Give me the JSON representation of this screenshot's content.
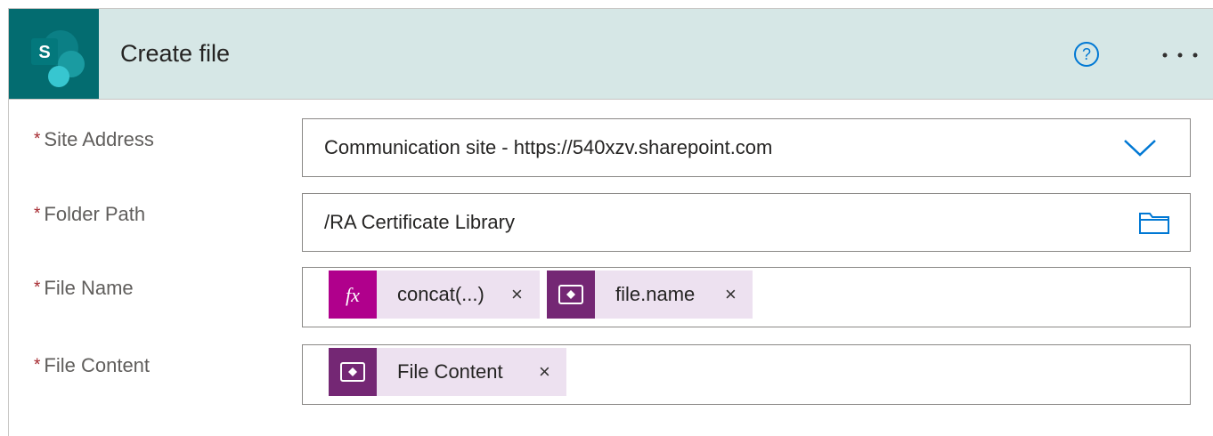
{
  "action": {
    "title": "Create file",
    "app_icon": "sharepoint-icon",
    "help_icon": "question-circle-icon",
    "more_label": "• • •"
  },
  "colors": {
    "header_bg": "#d6e7e6",
    "app_icon_bg": "#036c70",
    "required": "#a4262c",
    "help_blue": "#0078d4",
    "expression_token_icon": "#b0008c",
    "dynamic_token_icon": "#742774",
    "token_bg": "#ede1f0"
  },
  "fields": {
    "site_address": {
      "label": "Site Address",
      "required_mark": "*",
      "value": "Communication site - https://540xzv.sharepoint.com",
      "icon": "chevron-down-icon"
    },
    "folder_path": {
      "label": "Folder Path",
      "required_mark": "*",
      "value": "/RA Certificate Library",
      "icon": "folder-icon"
    },
    "file_name": {
      "label": "File Name",
      "required_mark": "*",
      "tokens": [
        {
          "label": "concat(...)",
          "icon": "fx-expression-icon",
          "remove": "×"
        },
        {
          "label": "file.name",
          "icon": "power-apps-icon",
          "remove": "×"
        }
      ]
    },
    "file_content": {
      "label": "File Content",
      "required_mark": "*",
      "tokens": [
        {
          "label": "File Content",
          "icon": "power-apps-icon",
          "remove": "×"
        }
      ]
    }
  }
}
